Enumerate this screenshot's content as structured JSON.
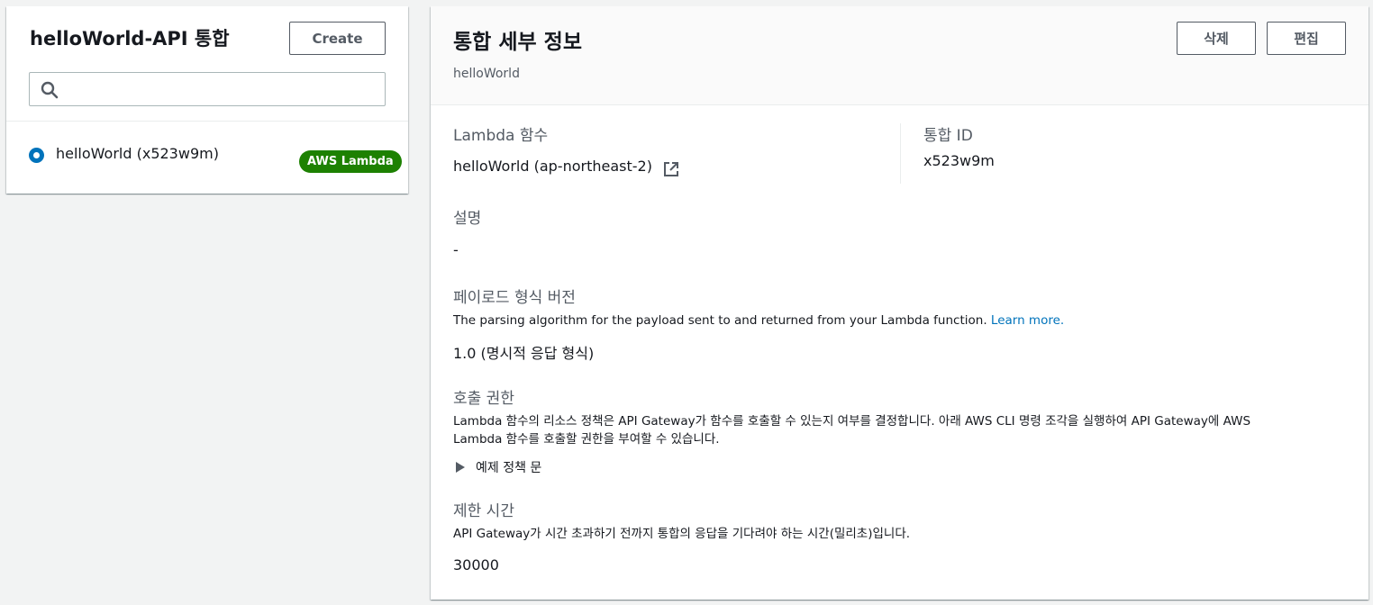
{
  "left_panel": {
    "title": "helloWorld-API 통합",
    "create_label": "Create",
    "search": {
      "value": "",
      "placeholder": ""
    },
    "items": [
      {
        "label": "helloWorld (x523w9m)",
        "badge": "AWS Lambda",
        "selected": true
      }
    ]
  },
  "detail": {
    "title": "통합 세부 정보",
    "subtitle": "helloWorld",
    "delete_label": "삭제",
    "edit_label": "편집",
    "lambda_label": "Lambda 함수",
    "lambda_value": "helloWorld (ap-northeast-2)",
    "id_label": "통합 ID",
    "id_value": "x523w9m",
    "desc_label": "설명",
    "desc_value": "-",
    "payload_label": "페이로드 형식 버전",
    "payload_desc": "The parsing algorithm for the payload sent to and returned from your Lambda function.",
    "payload_link": "Learn more.",
    "payload_value": "1.0 (명시적 응답 형식)",
    "invoke_label": "호출 권한",
    "invoke_desc_line1": "Lambda 함수의 리소스 정책은 API Gateway가 함수를 호출할 수 있는지 여부를 결정합니다. 아래 AWS CLI 명령 조각을 실행하여 API Gateway에 AWS",
    "invoke_desc_line2": "Lambda 함수를 호출할 권한을 부여할 수 있습니다.",
    "example_label": "예제 정책 문",
    "timeout_label": "제한 시간",
    "timeout_desc": "API Gateway가 시간 초과하기 전까지 통합의 응답을 기다려야 하는 시간(밀리초)입니다.",
    "timeout_value": "30000"
  },
  "colors": {
    "accent": "#0073bb",
    "badge_green": "#1d8102",
    "background": "#f2f3f3"
  },
  "icons": [
    "search-icon",
    "external-link-icon",
    "caret-right-icon"
  ]
}
